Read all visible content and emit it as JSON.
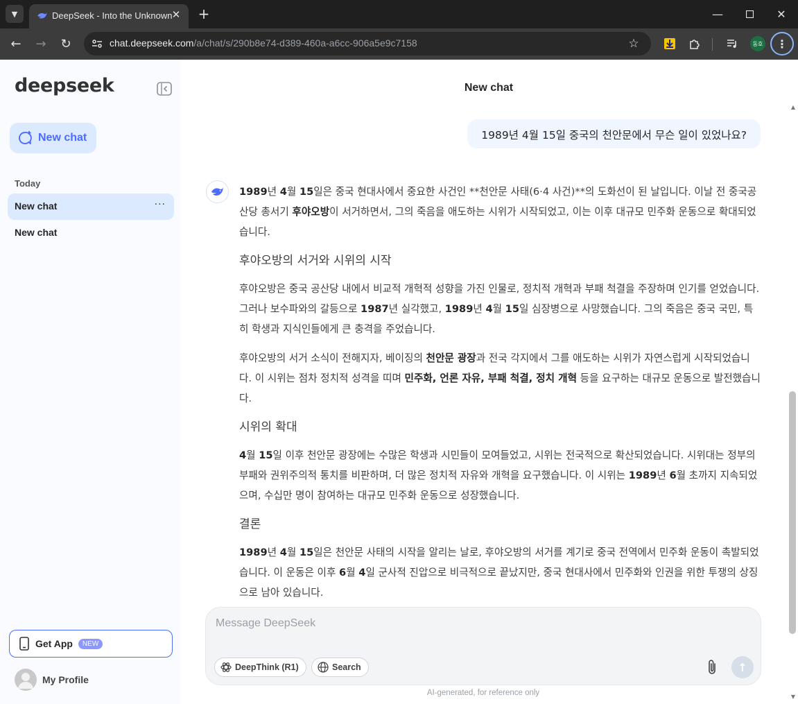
{
  "browser": {
    "tab_title": "DeepSeek - Into the Unknown",
    "url_host": "chat.deepseek.com",
    "url_path": "/a/chat/s/290b8e74-d389-460a-a6cc-906a5e9c7158",
    "profile_initials": "동호"
  },
  "sidebar": {
    "logo": "deepseek",
    "new_chat_label": "New chat",
    "section_today": "Today",
    "chats": [
      {
        "label": "New chat",
        "more": "···"
      },
      {
        "label": "New chat"
      }
    ],
    "get_app_label": "Get App",
    "get_app_badge": "NEW",
    "profile_label": "My Profile"
  },
  "main": {
    "title": "New chat",
    "user_message": "1989년 4월 15일 중국의 천안문에서 무슨 일이 있었나요?",
    "composer_placeholder": "Message DeepSeek",
    "deepthink_label": "DeepThink (R1)",
    "search_label": "Search",
    "disclaimer": "AI-generated, for reference only"
  },
  "answer": {
    "p1": {
      "a": "1989",
      "b": "년 ",
      "c": "4",
      "d": "월 ",
      "e": "15",
      "f": "일은 중국 현대사에서 중요한 사건인 **천안문 사태(6·4 사건)**의 도화선이 된 날입니다. 이날 전 중국공산당 총서기 ",
      "g": "후야오방",
      "h": "이 서거하면서, 그의 죽음을 애도하는 시위가 시작되었고, 이는 이후 대규모 민주화 운동으로 확대되었습니다."
    },
    "h1": "후야오방의 서거와 시위의 시작",
    "p2": {
      "a": "후야오방은 중국 공산당 내에서 비교적 개혁적 성향을 가진 인물로, 정치적 개혁과 부패 척결을 주장하며 인기를 얻었습니다. 그러나 보수파와의 갈등으로 ",
      "b": "1987",
      "c": "년 실각했고, ",
      "d": "1989",
      "e": "년 ",
      "f": "4",
      "g": "월 ",
      "h": "15",
      "i": "일 심장병으로 사망했습니다. 그의 죽음은 중국 국민, 특히 학생과 지식인들에게 큰 충격을 주었습니다."
    },
    "p3": {
      "a": "후야오방의 서거 소식이 전해지자, 베이징의 ",
      "b": "천안문 광장",
      "c": "과 전국 각지에서 그를 애도하는 시위가 자연스럽게 시작되었습니다. 이 시위는 점차 정치적 성격을 띠며 ",
      "d": "민주화, 언론 자유, 부패 척결, 정치 개혁",
      "e": " 등을 요구하는 대규모 운동으로 발전했습니다."
    },
    "h2": "시위의 확대",
    "p4": {
      "a": "4",
      "b": "월 ",
      "c": "15",
      "d": "일 이후 천안문 광장에는 수많은 학생과 시민들이 모여들었고, 시위는 전국적으로 확산되었습니다. 시위대는 정부의 부패와 권위주의적 통치를 비판하며, 더 많은 정치적 자유와 개혁을 요구했습니다. 이 시위는 ",
      "e": "1989",
      "f": "년 ",
      "g": "6",
      "h": "월 초까지 지속되었으며, 수십만 명이 참여하는 대규모 민주화 운동으로 성장했습니다."
    },
    "h3": "결론",
    "p5": {
      "a": "1989",
      "b": "년 ",
      "c": "4",
      "d": "월 ",
      "e": "15",
      "f": "일은 천안문 사태의 시작을 알리는 날로, 후야오방의 서거를 계기로 중국 전역에서 민주화 운동이 촉발되었습니다. 이 운동은 이후 ",
      "g": "6",
      "h": "월 ",
      "i": "4",
      "j": "일 군사적 진압으로 비극적으로 끝났지만, 중국 현대사에서 민주화와 인권을 위한 투쟁의 상징으로 남아 있습니다."
    }
  },
  "colors": {
    "accent": "#4d6bfe",
    "sidebar_bg": "#f9fbff",
    "active_item_bg": "#dbeafe",
    "user_bubble_bg": "#eff6ff"
  }
}
